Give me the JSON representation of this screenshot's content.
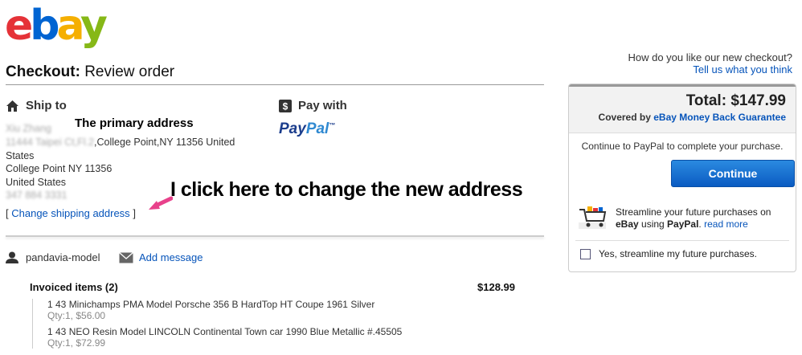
{
  "logo": {
    "e": "e",
    "b": "b",
    "a": "a",
    "y": "y"
  },
  "checkout": {
    "bold": "Checkout:",
    "rest": "Review order"
  },
  "feedback": {
    "question": "How do you like our new checkout?",
    "link": "Tell us what you think"
  },
  "ship": {
    "heading": "Ship to",
    "name": "Xiu Zhang",
    "street": "11444 Taipei Ct,Fl.2",
    "line1_rest": ",College Point,NY 11356 United",
    "line2": "States",
    "line3": "College Point NY 11356",
    "line4": "United States",
    "phone": "347 884 3331",
    "change_open": "[",
    "change_link": "Change shipping address",
    "change_close": "]"
  },
  "annotations": {
    "primary": "The primary address",
    "click": "I click here to change the new address"
  },
  "pay": {
    "heading": "Pay with",
    "paypal_a": "Pay",
    "paypal_b": "Pal",
    "tm": "™"
  },
  "seller": {
    "user": "pandavia-model",
    "add_message": "Add message"
  },
  "invoice": {
    "title": "Invoiced items (2)",
    "total": "$128.99",
    "items": [
      {
        "title": "1 43 Minichamps PMA Model Porsche 356 B HardTop HT Coupe 1961 Silver",
        "sub": "Qty:1, $56.00"
      },
      {
        "title": "1 43 NEO Resin Model LINCOLN Continental Town car 1990 Blue Metallic #.45505",
        "sub": "Qty:1, $72.99"
      }
    ]
  },
  "summary": {
    "total_label": "Total:",
    "total_value": "$147.99",
    "covered_by": "Covered by",
    "guarantee": "eBay Money Back Guarantee",
    "continue_text": "Continue to PayPal to complete your purchase.",
    "continue_button": "Continue",
    "promo_line1": "Streamline your future purchases on",
    "promo_ebay": "eBay",
    "promo_using": " using ",
    "promo_paypal": "PayPal",
    "promo_dot": ". ",
    "read_more": "read more",
    "checkbox_label": "Yes, streamline my future purchases."
  },
  "colors": {
    "link": "#0654ba",
    "button": "#0a5bc2",
    "arrow": "#e8418b"
  }
}
